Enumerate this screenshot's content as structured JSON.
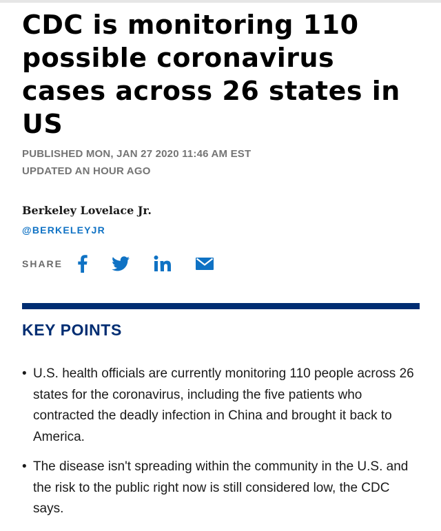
{
  "article": {
    "headline": "CDC is monitoring 110 possible coronavirus cases across 26 states in US",
    "published": "PUBLISHED MON, JAN 27 2020 11:46 AM EST",
    "updated": "UPDATED AN HOUR AGO",
    "author": {
      "name": "Berkeley Lovelace Jr.",
      "handle": "@BERKELEYJR"
    },
    "share": {
      "label": "SHARE",
      "buttons": [
        {
          "icon": "facebook-icon"
        },
        {
          "icon": "twitter-icon"
        },
        {
          "icon": "linkedin-icon"
        },
        {
          "icon": "email-icon"
        }
      ]
    },
    "key_points": {
      "title": "KEY POINTS",
      "items": [
        "U.S. health officials are currently monitoring 110 people across 26 states for the coronavirus, including the five patients who contracted the deadly infection in China and brought it back to America.",
        "The disease isn't spreading within the community in the U.S. and the risk to the public right now is still considered low, the CDC says."
      ]
    }
  },
  "colors": {
    "brand_navy": "#002d72",
    "link_blue": "#0f72c4",
    "meta_gray": "#747474"
  }
}
